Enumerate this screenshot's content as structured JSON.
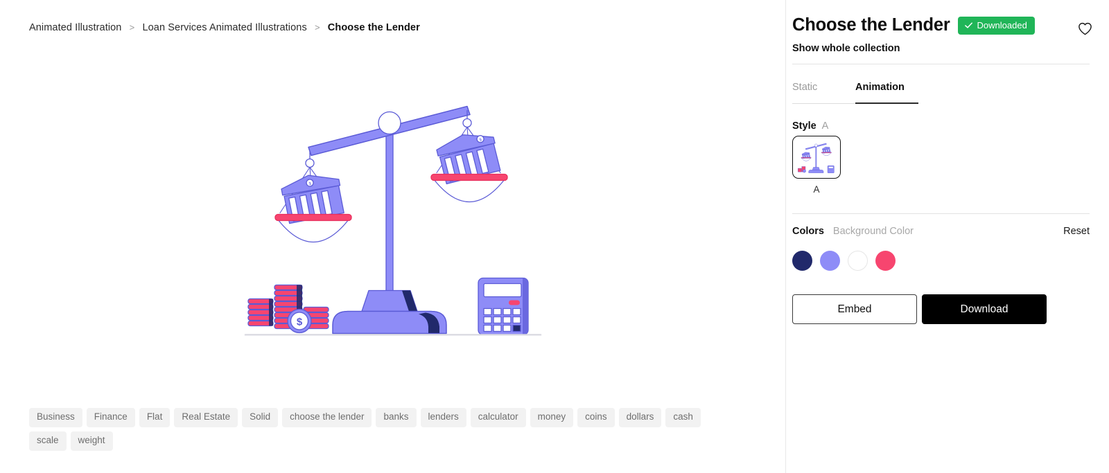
{
  "breadcrumb": {
    "items": [
      {
        "label": "Animated Illustration",
        "current": false
      },
      {
        "label": "Loan Services Animated Illustrations",
        "current": false
      },
      {
        "label": "Choose the Lender",
        "current": true
      }
    ],
    "separator": ">"
  },
  "illustration": {
    "name": "choose-the-lender-scale-illustration",
    "alt": "Balance scale weighing two bank buildings with coin stacks and a calculator",
    "colors": {
      "periwinkle": "#7b7bf0",
      "periwinkle_light": "#8e8cf7",
      "navy": "#21296b",
      "pink": "#f7456f",
      "pink_dark": "#e82f5e",
      "white": "#ffffff",
      "ground": "#d8d8e0"
    }
  },
  "tags": [
    "Business",
    "Finance",
    "Flat",
    "Real Estate",
    "Solid",
    "choose the lender",
    "banks",
    "lenders",
    "calculator",
    "money",
    "coins",
    "dollars",
    "cash",
    "scale",
    "weight"
  ],
  "panel": {
    "title": "Choose the Lender",
    "badge": {
      "label": "Downloaded",
      "color": "#20b558",
      "icon": "check-icon"
    },
    "favorite_icon": "heart-outline-icon",
    "show_collection_link": "Show whole collection",
    "tabs": [
      {
        "label": "Static",
        "active": false
      },
      {
        "label": "Animation",
        "active": true
      }
    ],
    "style": {
      "label": "Style",
      "value": "A",
      "options": [
        {
          "label": "A",
          "selected": true
        }
      ]
    },
    "colors": {
      "label": "Colors",
      "background_label": "Background Color",
      "reset_label": "Reset",
      "swatches": [
        {
          "name": "navy",
          "hex": "#21296b"
        },
        {
          "name": "periwinkle",
          "hex": "#8e8cf7"
        },
        {
          "name": "white",
          "hex": "#ffffff"
        },
        {
          "name": "pink",
          "hex": "#f7456f"
        }
      ]
    },
    "actions": {
      "embed_label": "Embed",
      "download_label": "Download"
    }
  }
}
